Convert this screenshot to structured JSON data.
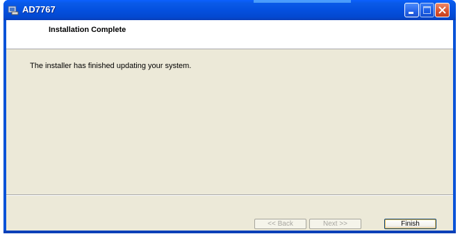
{
  "window": {
    "title": "AD7767",
    "buttons": {
      "minimize": "minimize",
      "maximize": "maximize",
      "close": "close"
    }
  },
  "header": {
    "title": "Installation Complete"
  },
  "body": {
    "message": "The installer has finished updating your system."
  },
  "footer": {
    "back_label": "<< Back",
    "next_label": "Next >>",
    "finish_label": "Finish"
  },
  "colors": {
    "titlebar": "#0450df",
    "client_bg": "#ece9d8",
    "close_button": "#d8502b"
  },
  "icons": [
    "app-icon",
    "minimize-icon",
    "maximize-icon",
    "close-icon"
  ]
}
